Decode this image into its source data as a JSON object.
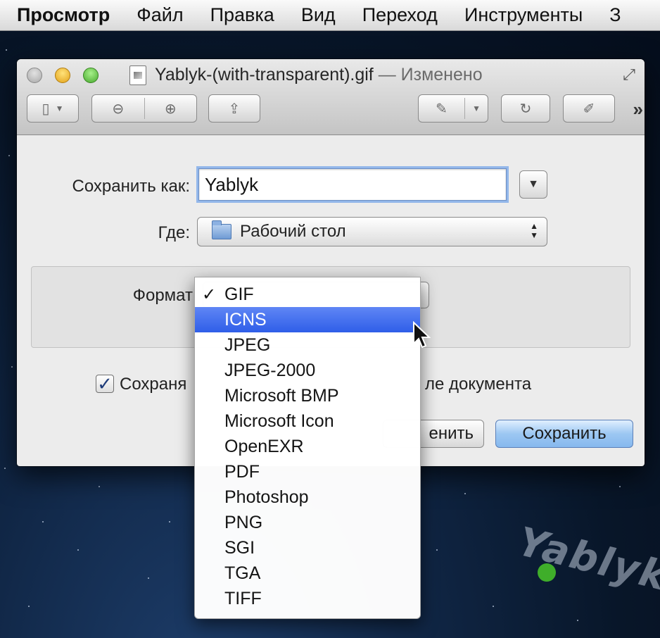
{
  "menubar": {
    "items": [
      "Просмотр",
      "Файл",
      "Правка",
      "Вид",
      "Переход",
      "Инструменты",
      "З"
    ]
  },
  "window": {
    "filename": "Yablyk-(with-transparent).gif",
    "status": "— Изменено"
  },
  "save_sheet": {
    "save_as_label": "Сохранить как:",
    "save_as_value": "Yablyk",
    "where_label": "Где:",
    "where_value": "Рабочий стол",
    "format_label": "Формат",
    "checkbox_label_visible": "Сохраня",
    "checkbox_label_tail": "ле документа",
    "checkbox_checked": true,
    "cancel_label_visible": "енить",
    "save_label": "Сохранить"
  },
  "format_menu": {
    "selected": "GIF",
    "highlighted": "ICNS",
    "options": [
      "GIF",
      "ICNS",
      "JPEG",
      "JPEG-2000",
      "Microsoft BMP",
      "Microsoft Icon",
      "OpenEXR",
      "PDF",
      "Photoshop",
      "PNG",
      "SGI",
      "TGA",
      "TIFF"
    ]
  },
  "icons": {
    "sidebar": "sidebar-icon",
    "zoom_out": "zoom-out-icon",
    "zoom_in": "zoom-in-icon",
    "share": "share-icon",
    "annotate": "pen-icon",
    "rotate": "rotate-icon",
    "edit": "edit-toolbar-icon",
    "overflow": "double-chevron-icon"
  },
  "watermark": "Yablyk",
  "colors": {
    "highlight": "#2f5ee8",
    "save_button": "#9cc7f2",
    "focus_ring": "#93b7ea"
  }
}
